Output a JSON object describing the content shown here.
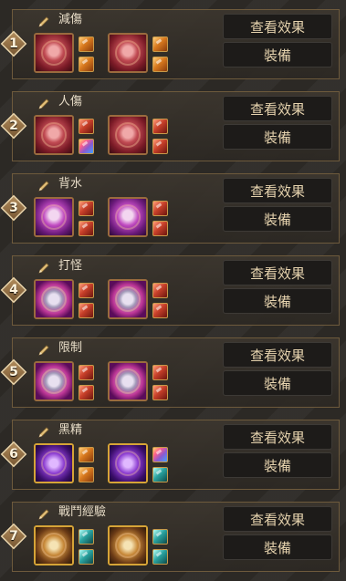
{
  "sets": [
    {
      "index": "1",
      "name": "減傷",
      "orb_style": "red-skull",
      "gems": [
        "orange",
        "orange",
        "orange",
        "orange"
      ],
      "view_label": "查看效果",
      "equip_label": "裝備"
    },
    {
      "index": "2",
      "name": "人傷",
      "orb_style": "red-skull",
      "gems": [
        "red",
        "rainbow",
        "red",
        "red"
      ],
      "view_label": "查看效果",
      "equip_label": "裝備"
    },
    {
      "index": "3",
      "name": "背水",
      "orb_style": "purple-skull",
      "gems": [
        "red",
        "red",
        "red",
        "red"
      ],
      "view_label": "查看效果",
      "equip_label": "裝備"
    },
    {
      "index": "4",
      "name": "打怪",
      "orb_style": "purple-orb",
      "gems": [
        "red",
        "red",
        "red",
        "red"
      ],
      "view_label": "查看效果",
      "equip_label": "裝備"
    },
    {
      "index": "5",
      "name": "限制",
      "orb_style": "purple-orb",
      "gems": [
        "red",
        "red",
        "red",
        "red"
      ],
      "view_label": "查看效果",
      "equip_label": "裝備"
    },
    {
      "index": "6",
      "name": "黑精",
      "orb_style": "gold-ring",
      "gems": [
        "orange",
        "orange",
        "rainbow",
        "teal"
      ],
      "view_label": "查看效果",
      "equip_label": "裝備"
    },
    {
      "index": "7",
      "name": "戰鬥經驗",
      "orb_style": "gold-compass",
      "gems": [
        "teal",
        "teal",
        "teal",
        "teal"
      ],
      "view_label": "查看效果",
      "equip_label": "裝備"
    }
  ],
  "colors": {
    "orange": "#d8791e",
    "red": "#c8402a",
    "teal": "#2aa3a0",
    "rainbow": "#8a5ad0",
    "button_text": "#e6d3ae",
    "border": "#6e5a3c"
  },
  "icons": {
    "edit": "pencil-icon",
    "orb": "soul-orb-icon",
    "gem": "gem-icon"
  }
}
